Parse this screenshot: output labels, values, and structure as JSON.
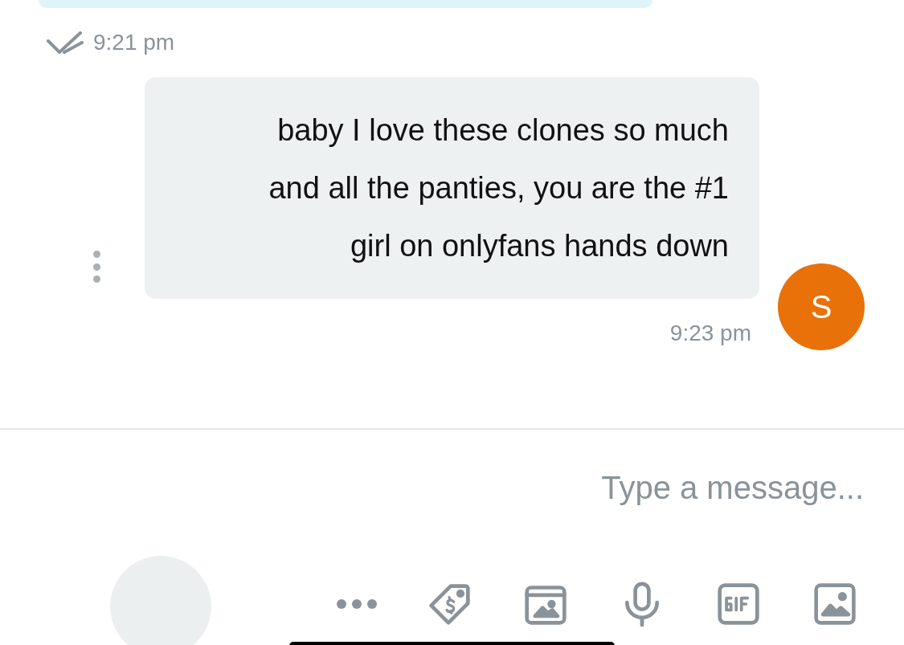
{
  "messages": [
    {
      "kind": "outgoing",
      "time": "9:21 pm",
      "read": true
    },
    {
      "kind": "incoming",
      "avatar": "S",
      "text": "baby I love these clones so much and all the panties, you are the #1 girl on onlyfans hands down",
      "time": "9:23 pm"
    }
  ],
  "composer": {
    "placeholder": "Type a message..."
  }
}
